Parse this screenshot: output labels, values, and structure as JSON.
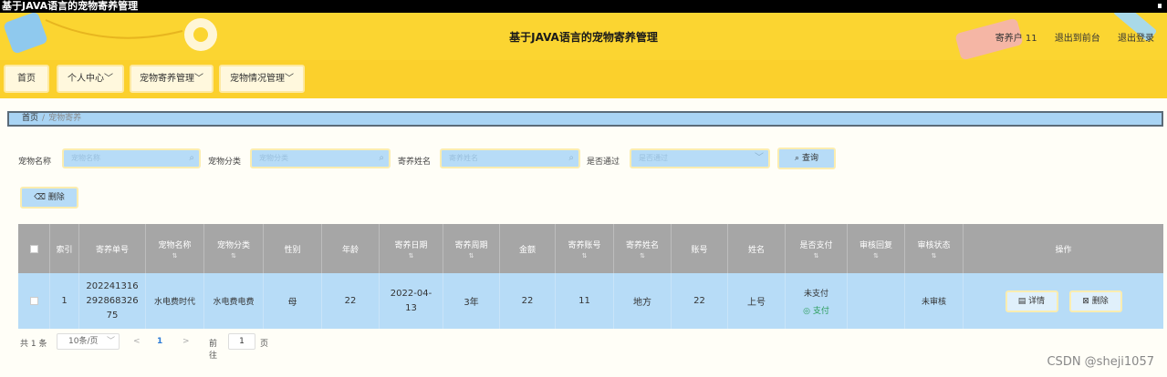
{
  "window": {
    "title": "基于JAVA语言的宠物寄养管理"
  },
  "header": {
    "title": "基于JAVA语言的宠物寄养管理",
    "user": "寄养户 11",
    "to_front": "退出到前台",
    "logout": "退出登录"
  },
  "nav": {
    "home": "首页",
    "personal": "个人中心",
    "foster_mgmt": "宠物寄养管理",
    "status_mgmt": "宠物情况管理"
  },
  "breadcrumb": {
    "home": "首页",
    "sep": "/",
    "current": "宠物寄养"
  },
  "search": {
    "pet_name_label": "宠物名称",
    "pet_name_placeholder": "宠物名称",
    "category_label": "宠物分类",
    "category_placeholder": "宠物分类",
    "owner_label": "寄养姓名",
    "owner_placeholder": "寄养姓名",
    "approved_label": "是否通过",
    "approved_placeholder": "是否通过",
    "query_button": "查询"
  },
  "toolbar": {
    "delete_button": "删除"
  },
  "table": {
    "headers": [
      "索引",
      "寄养单号",
      "宠物名称",
      "宠物分类",
      "性别",
      "年龄",
      "寄养日期",
      "寄养周期",
      "金额",
      "寄养账号",
      "寄养姓名",
      "账号",
      "姓名",
      "是否支付",
      "审核回复",
      "审核状态",
      "操作"
    ],
    "sort_mark": "⇅",
    "row": {
      "index": "1",
      "order_no": "20224131629286832675",
      "pet_name": "水电费时代",
      "category": "水电费电费",
      "gender": "母",
      "age": "22",
      "date": "2022-04-13",
      "period": "3年",
      "amount": "22",
      "foster_account": "11",
      "foster_name": "地方",
      "account": "22",
      "name": "上号",
      "paid": "未支付",
      "pay_link": "支付",
      "reply": "",
      "audit_status": "未审核",
      "detail_button": "详情",
      "delete_button": "删除"
    }
  },
  "pager": {
    "total": "共 1 条",
    "page_size": "10条/页",
    "prev": "<",
    "page": "1",
    "next": ">",
    "goto": "前往",
    "goto_value": "1",
    "unit": "页"
  },
  "watermark": "CSDN @sheji1057",
  "colors": {
    "header_bg": "#fbd531",
    "row_bg": "#b7dcf7",
    "head_bg": "#a6a6a6"
  }
}
